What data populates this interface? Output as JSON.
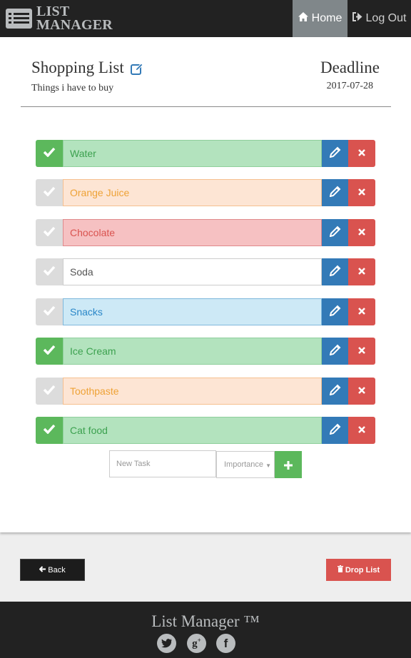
{
  "navbar": {
    "brand_line1": "LIST",
    "brand_line2": "MANAGER",
    "brand_icon": "list-icon",
    "home_label": "Home",
    "home_icon": "home-icon",
    "logout_label": "Log Out",
    "logout_icon": "sign-out-icon"
  },
  "list": {
    "title": "Shopping List",
    "title_edit_icon": "edit-icon",
    "description": "Things i have to buy",
    "deadline_label": "Deadline",
    "deadline_date": "2017-07-28"
  },
  "tasks": [
    {
      "name": "Water",
      "done": true,
      "importance": "success"
    },
    {
      "name": "Orange Juice",
      "done": false,
      "importance": "warning"
    },
    {
      "name": "Chocolate",
      "done": false,
      "importance": "danger"
    },
    {
      "name": "Soda",
      "done": false,
      "importance": "default"
    },
    {
      "name": "Snacks",
      "done": false,
      "importance": "info"
    },
    {
      "name": "Ice Cream",
      "done": true,
      "importance": "success"
    },
    {
      "name": "Toothpaste",
      "done": false,
      "importance": "warning"
    },
    {
      "name": "Cat food",
      "done": true,
      "importance": "success"
    }
  ],
  "new_task": {
    "placeholder": "New Task",
    "importance_placeholder": "Importance",
    "add_icon": "plus-icon"
  },
  "actions": {
    "back_label": "Back",
    "back_icon": "arrow-left-icon",
    "drop_label": "Drop List",
    "drop_icon": "trash-icon"
  },
  "footer": {
    "title": "List Manager ™",
    "social_icons": [
      "twitter-icon",
      "google-plus-icon",
      "facebook-icon"
    ]
  },
  "colors": {
    "navbar_bg": "#222222",
    "active_nav": "#80878a",
    "success": "#5cb85c",
    "primary": "#337ab7",
    "danger": "#d9534f"
  }
}
